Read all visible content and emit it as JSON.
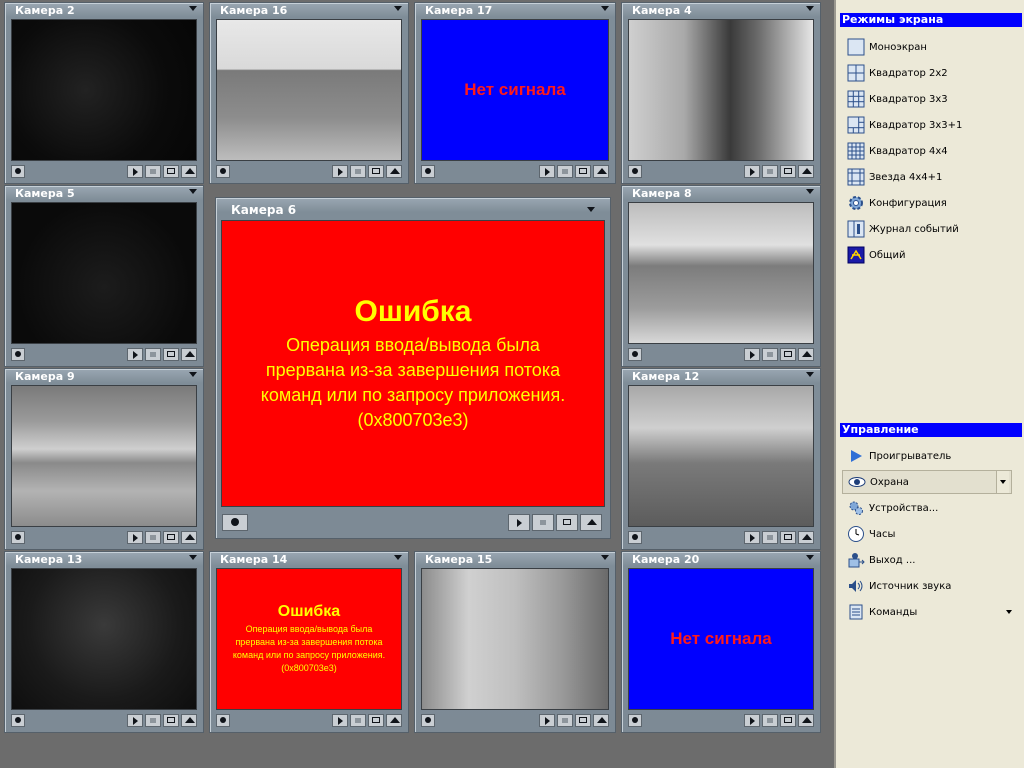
{
  "cameras": {
    "cam2": {
      "title": "Камера  2"
    },
    "cam16": {
      "title": "Камера 16"
    },
    "cam17": {
      "title": "Камера 17",
      "message": "Нет сигнала"
    },
    "cam4": {
      "title": "Камера  4"
    },
    "cam5": {
      "title": "Камера 5"
    },
    "cam6": {
      "title": "Камера 6",
      "error_title": "Ошибка",
      "error_lines": [
        "Операция ввода/вывода была",
        "прервана из-за завершения потока",
        "команд или по запросу приложения.",
        "(0x800703e3)"
      ]
    },
    "cam8": {
      "title": "Камера 8"
    },
    "cam9": {
      "title": "Камера  9"
    },
    "cam12": {
      "title": "Камера 12"
    },
    "cam13": {
      "title": "Камера 13"
    },
    "cam14": {
      "title": "Камера 14",
      "error_title": "Ошибка",
      "error_lines": [
        "Операция ввода/вывода была",
        "прервана из-за завершения потока",
        "команд или по запросу приложения.",
        "(0x800703e3)"
      ]
    },
    "cam15": {
      "title": "Камера 15"
    },
    "cam20": {
      "title": "Камера 20",
      "message": "Нет сигнала"
    }
  },
  "sidebar": {
    "screen_modes": {
      "header": "Режимы экрана",
      "items": [
        {
          "label": "Моноэкран",
          "icon": "mono-screen-icon"
        },
        {
          "label": "Квадратор 2х2",
          "icon": "grid-2x2-icon"
        },
        {
          "label": "Квадратор 3х3",
          "icon": "grid-3x3-icon"
        },
        {
          "label": "Квадратор 3х3+1",
          "icon": "grid-3x3-plus-1-icon"
        },
        {
          "label": "Квадратор 4х4",
          "icon": "grid-4x4-icon"
        },
        {
          "label": "Звезда 4х4+1",
          "icon": "star-4x4-plus-1-icon"
        },
        {
          "label": "Конфигурация",
          "icon": "configuration-icon"
        },
        {
          "label": "Журнал событий",
          "icon": "event-log-icon"
        },
        {
          "label": "Общий",
          "icon": "general-icon"
        }
      ]
    },
    "control": {
      "header": "Управление",
      "items": [
        {
          "label": "Проигрыватель",
          "icon": "player-icon"
        },
        {
          "label": "Охрана",
          "icon": "eye-icon"
        },
        {
          "label": "Устройства...",
          "icon": "devices-icon"
        },
        {
          "label": "Часы",
          "icon": "clock-icon"
        },
        {
          "label": "Выход ...",
          "icon": "exit-icon"
        },
        {
          "label": "Источник звука",
          "icon": "sound-source-icon"
        },
        {
          "label": "Команды",
          "icon": "commands-icon"
        }
      ]
    }
  },
  "colors": {
    "no_signal_bg": "#0000ff",
    "no_signal_text": "#ff1a1a",
    "error_bg": "#ff0000",
    "error_text": "#ffff00",
    "sidebar_header_bg": "#0000ff"
  }
}
